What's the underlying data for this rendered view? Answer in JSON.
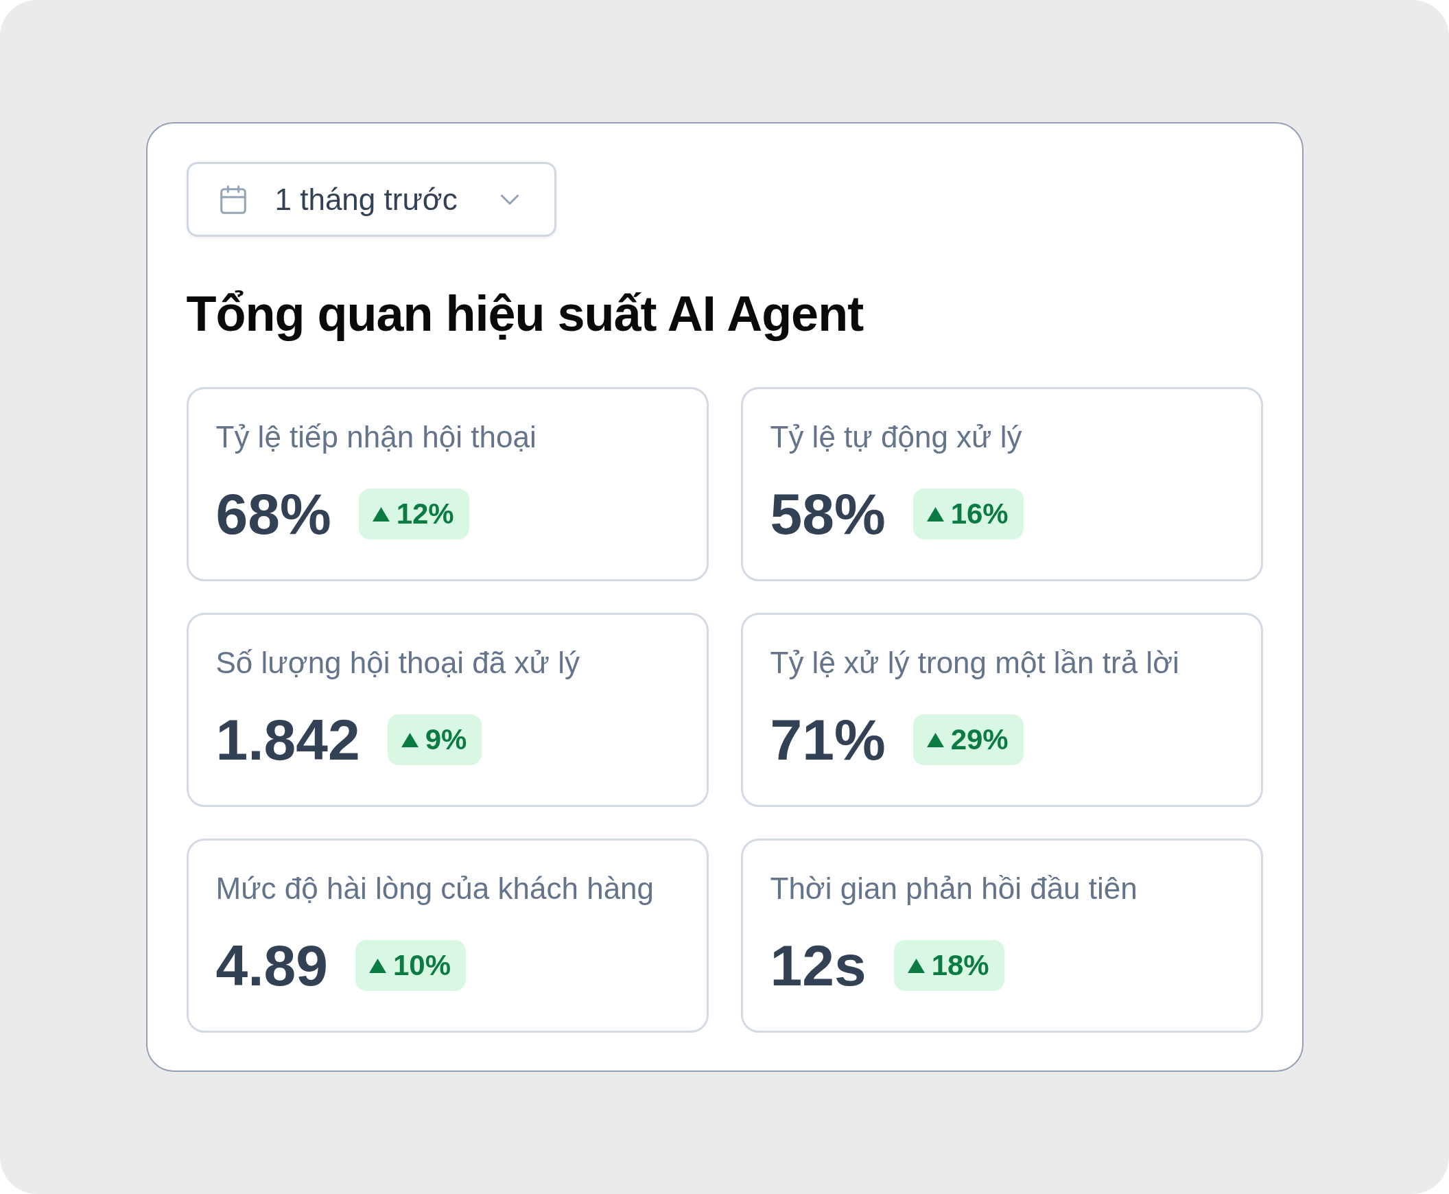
{
  "date_filter": {
    "label": "1 tháng trước"
  },
  "title": "Tổng quan hiệu suất AI Agent",
  "metrics": [
    {
      "label": "Tỷ lệ tiếp nhận hội thoại",
      "value": "68%",
      "change": "12%"
    },
    {
      "label": "Tỷ lệ tự động xử lý",
      "value": "58%",
      "change": "16%"
    },
    {
      "label": "Số lượng hội thoại đã xử lý",
      "value": "1.842",
      "change": "9%"
    },
    {
      "label": "Tỷ lệ xử lý trong một lần trả lời",
      "value": "71%",
      "change": "29%"
    },
    {
      "label": "Mức độ hài lòng của khách hàng",
      "value": "4.89",
      "change": "10%"
    },
    {
      "label": "Thời gian phản hồi đầu tiên",
      "value": "12s",
      "change": "18%"
    }
  ]
}
